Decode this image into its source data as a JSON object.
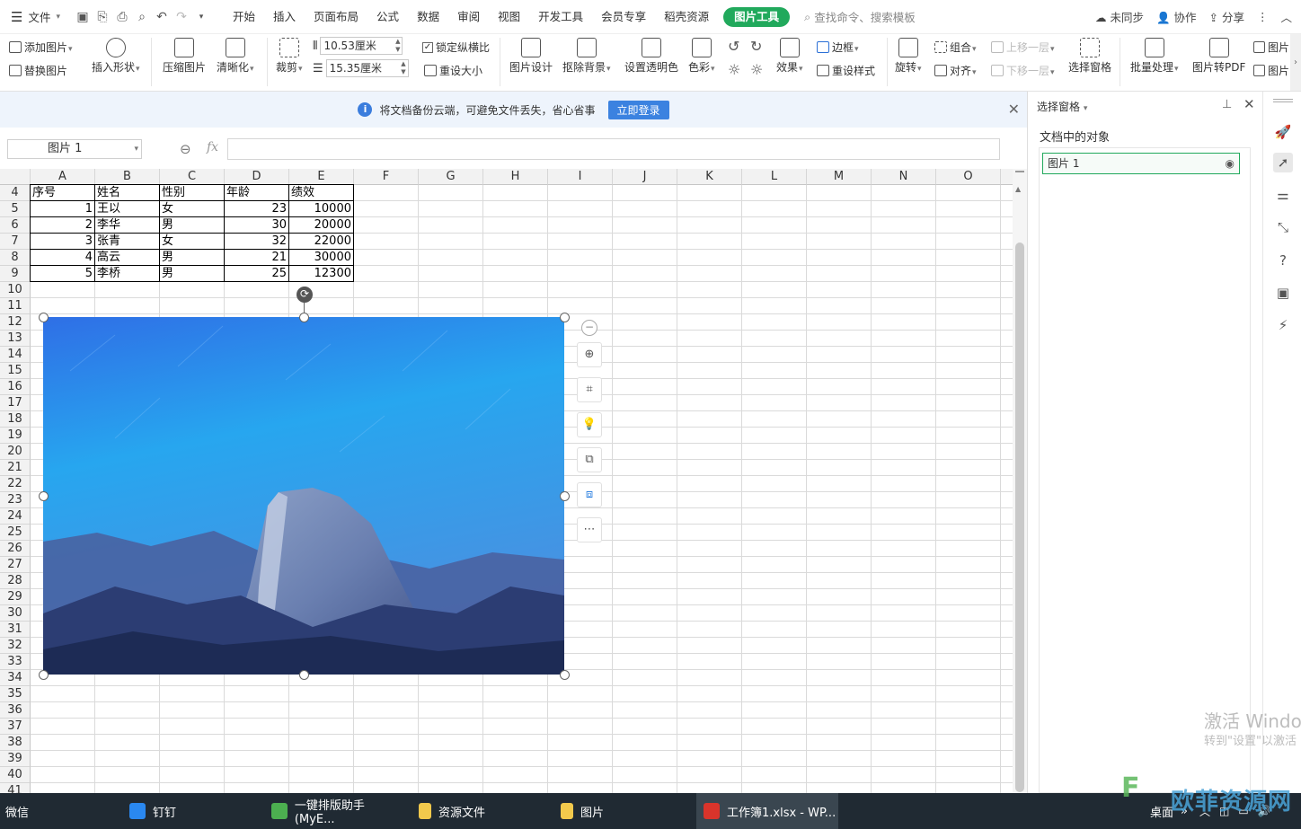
{
  "menubar": {
    "file_label": "文件",
    "tabs": [
      "开始",
      "插入",
      "页面布局",
      "公式",
      "数据",
      "审阅",
      "视图",
      "开发工具",
      "会员专享",
      "稻壳资源"
    ],
    "active_tab": "图片工具",
    "search_placeholder": "查找命令、搜索模板",
    "right": {
      "sync": "未同步",
      "collab": "协作",
      "share": "分享"
    }
  },
  "ribbon": {
    "add_picture": "添加图片",
    "replace_picture": "替换图片",
    "insert_shape": "插入形状",
    "compress": "压缩图片",
    "sharpen": "清晰化",
    "crop": "裁剪",
    "width": "10.53厘米",
    "height": "15.35厘米",
    "lock_ratio": "锁定纵横比",
    "reset_size": "重设大小",
    "picture_design": "图片设计",
    "remove_bg": "抠除背景",
    "set_transparent": "设置透明色",
    "color": "色彩",
    "effects": "效果",
    "border": "边框",
    "reset_style": "重设样式",
    "rotate": "旋转",
    "group": "组合",
    "align": "对齐",
    "bring_forward": "上移一层",
    "send_backward": "下移一层",
    "selection_pane": "选择窗格",
    "batch": "批量处理",
    "to_pdf": "图片转PDF",
    "more1": "图片",
    "more2": "图片"
  },
  "notice": {
    "text": "将文档备份云端，可避免文件丢失，省心省事",
    "button": "立即登录"
  },
  "formula": {
    "name_box": "图片 1",
    "fx": "fx"
  },
  "grid": {
    "columns": [
      "A",
      "B",
      "C",
      "D",
      "E",
      "F",
      "G",
      "H",
      "I",
      "J",
      "K",
      "L",
      "M",
      "N",
      "O"
    ],
    "rows": [
      "4",
      "5",
      "6",
      "7",
      "8",
      "9",
      "10",
      "11",
      "12",
      "13",
      "14",
      "15",
      "16",
      "17",
      "18",
      "19",
      "20",
      "21",
      "22",
      "23",
      "24",
      "25",
      "26",
      "27",
      "28",
      "29",
      "30",
      "31",
      "32",
      "33",
      "34",
      "35",
      "36",
      "37",
      "38",
      "39",
      "40",
      "41"
    ],
    "table_header": [
      "序号",
      "姓名",
      "性别",
      "年龄",
      "绩效"
    ],
    "table_rows": [
      [
        "1",
        "王以",
        "女",
        "23",
        "10000"
      ],
      [
        "2",
        "李华",
        "男",
        "30",
        "20000"
      ],
      [
        "3",
        "张青",
        "女",
        "32",
        "22000"
      ],
      [
        "4",
        "高云",
        "男",
        "21",
        "30000"
      ],
      [
        "5",
        "李桥",
        "男",
        "25",
        "12300"
      ]
    ]
  },
  "pane": {
    "title": "选择窗格",
    "subtitle": "文档中的对象",
    "item": "图片 1"
  },
  "watermark": {
    "line1": "激活 Windo",
    "line2": "转到\"设置\"以激活"
  },
  "taskbar": {
    "items": [
      "微信",
      "钉钉",
      "一键排版助手(MyE...",
      "资源文件",
      "图片",
      "工作簿1.xlsx - WP..."
    ],
    "desktop": "桌面"
  },
  "site_logo": "欧菲资源网",
  "colors": {
    "accent": "#21a95c",
    "notice_bg": "#eef4fc",
    "login_btn": "#3b82e0",
    "taskbar": "#202a33"
  }
}
